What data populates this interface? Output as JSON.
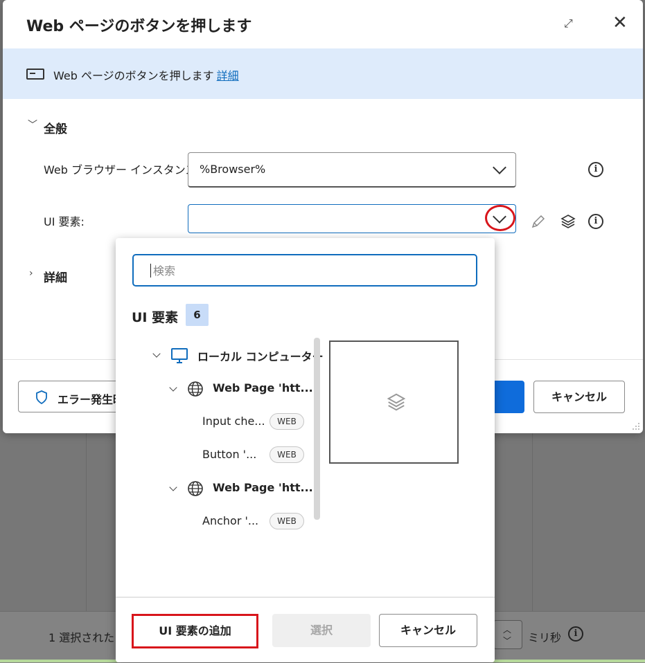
{
  "dialog": {
    "title": "Web ページのボタンを押します",
    "banner_text": "Web ページのボタンを押します",
    "banner_link": "詳細",
    "section_general": "全般",
    "section_details": "詳細",
    "browser_label": "Web ブラウザー インスタンス:",
    "browser_value": "%Browser%",
    "ui_element_label": "UI 要素:",
    "ui_element_value": "",
    "error_button": "エラー発生時",
    "cancel_button": "キャンセル"
  },
  "picker": {
    "search_placeholder": "検索",
    "heading": "UI 要素",
    "count": "6",
    "tree": {
      "root": "ローカル コンピューター",
      "group1": "Web Page 'htt...",
      "item1": "Input che...",
      "item2": "Button '...",
      "group2": "Web Page 'htt...",
      "item3": "Anchor '...",
      "badge": "WEB"
    },
    "add_button": "UI 要素の追加",
    "select_button": "選択",
    "cancel_button": "キャンセル"
  },
  "background": {
    "status_text": "1 選択された",
    "unit": "ミリ秒"
  },
  "colors": {
    "accent": "#0f6cbd",
    "primary": "#0f6cdb",
    "highlight": "#d8151b",
    "banner": "#deebfb"
  }
}
